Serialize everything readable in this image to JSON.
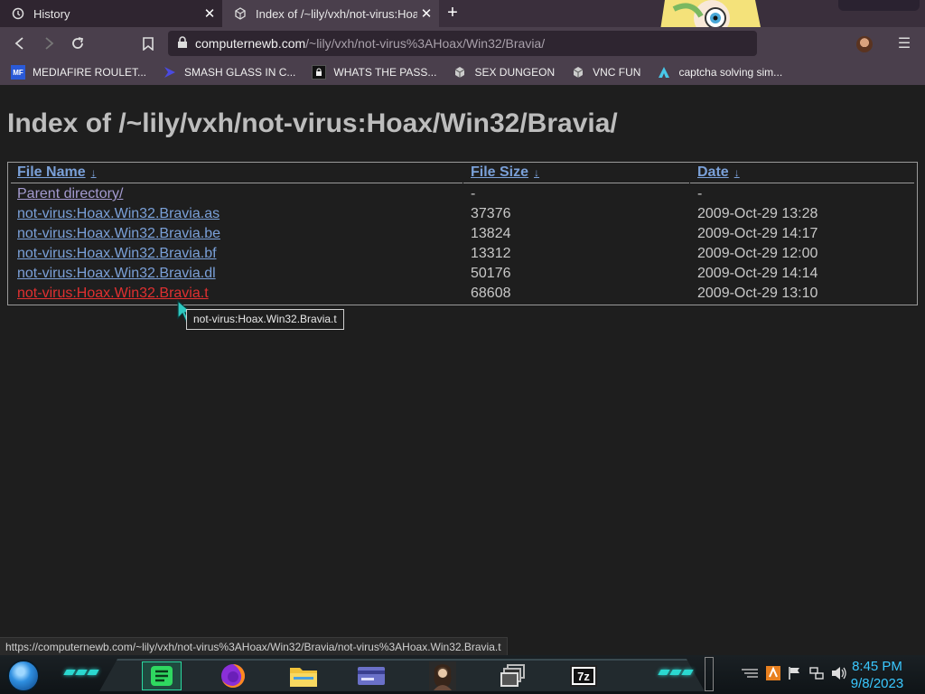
{
  "browser": {
    "tabs": [
      {
        "label": "History",
        "icon": "history-icon"
      },
      {
        "label": "Index of /~lily/vxh/not-virus:Hoax/",
        "icon": "page-icon"
      }
    ],
    "url": {
      "host": "computernewb.com",
      "path": "/~lily/vxh/not-virus%3AHoax/Win32/Bravia/"
    },
    "bookmarks": [
      {
        "label": "MEDIAFIRE ROULET...",
        "icon": "mediafire-icon",
        "color": "#2a5ad8"
      },
      {
        "label": "SMASH GLASS IN C...",
        "icon": "chevron-logo-icon",
        "color": "#4a4ae0"
      },
      {
        "label": "WHATS THE PASS...",
        "icon": "lock-favicon-icon",
        "color": "#111111"
      },
      {
        "label": "SEX DUNGEON",
        "icon": "vm-favicon-icon",
        "color": "#dddddd"
      },
      {
        "label": "VNC FUN",
        "icon": "vm-favicon-icon",
        "color": "#dddddd"
      },
      {
        "label": "captcha solving sim...",
        "icon": "triangle-logo-icon",
        "color": "#48c8e8"
      }
    ]
  },
  "page": {
    "title": "Index of /~lily/vxh/not-virus:Hoax/Win32/Bravia/",
    "columns": {
      "name": "File Name",
      "size": "File Size",
      "date": "Date",
      "sort_arrow": "↓"
    },
    "rows": [
      {
        "name": "Parent directory/",
        "size": "-",
        "date": "-"
      },
      {
        "name": "not-virus:Hoax.Win32.Bravia.as",
        "size": "37376",
        "date": "2009-Oct-29 13:28"
      },
      {
        "name": "not-virus:Hoax.Win32.Bravia.be",
        "size": "13824",
        "date": "2009-Oct-29 14:17"
      },
      {
        "name": "not-virus:Hoax.Win32.Bravia.bf",
        "size": "13312",
        "date": "2009-Oct-29 12:00"
      },
      {
        "name": "not-virus:Hoax.Win32.Bravia.dl",
        "size": "50176",
        "date": "2009-Oct-29 14:14"
      },
      {
        "name": "not-virus:Hoax.Win32.Bravia.t",
        "size": "68608",
        "date": "2009-Oct-29 13:10"
      }
    ],
    "tooltip": "not-virus:Hoax.Win32.Bravia.t",
    "status_url": "https://computernewb.com/~lily/vxh/not-virus%3AHoax/Win32/Bravia/not-virus%3AHoax.Win32.Bravia.t"
  },
  "taskbar": {
    "apps": [
      "notes-app-icon",
      "firefox-icon",
      "file-explorer-icon",
      "card-app-icon",
      "portrait-app-icon",
      "window-switcher-icon",
      "7zip-icon"
    ],
    "seven_zip_label": "7z",
    "time": "8:45 PM",
    "date": "9/8/2023"
  },
  "colors": {
    "link": "#7aa0d8",
    "visited": "#a49bd0",
    "hover": "#e03030",
    "clock": "#3ac8ff",
    "page_bg": "#1e1e1e"
  }
}
